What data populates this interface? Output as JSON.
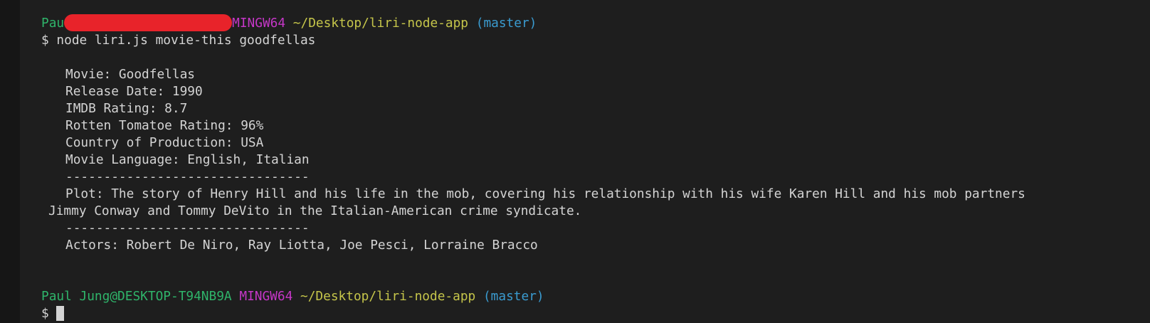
{
  "prompt1": {
    "user_visible": "Pau",
    "env": "MINGW64",
    "path": "~/Desktop/liri-node-app",
    "branch": "(master)"
  },
  "command": "$ node liri.js movie-this goodfellas",
  "output": {
    "movie": "Movie: Goodfellas",
    "release": "Release Date: 1990",
    "imdb": "IMDB Rating: 8.7",
    "rotten": "Rotten Tomatoe Rating: 96%",
    "country": "Country of Production: USA",
    "language": "Movie Language: English, Italian",
    "divider": "--------------------------------",
    "plot_line1": "Plot: The story of Henry Hill and his life in the mob, covering his relationship with his wife Karen Hill and his mob partners",
    "plot_line2": "Jimmy Conway and Tommy DeVito in the Italian-American crime syndicate.",
    "actors": "Actors: Robert De Niro, Ray Liotta, Joe Pesci, Lorraine Bracco"
  },
  "prompt2": {
    "user": "Paul Jung@DESKTOP-T94NB9A",
    "env": "MINGW64",
    "path": "~/Desktop/liri-node-app",
    "branch": "(master)"
  },
  "input_prompt": "$",
  "colors": {
    "background": "#1e1e1e",
    "text": "#d4d4d4",
    "user": "#2fb46a",
    "env": "#c537c7",
    "path": "#c5c54a",
    "branch": "#3a9bd0",
    "redaction": "#e8232a"
  }
}
